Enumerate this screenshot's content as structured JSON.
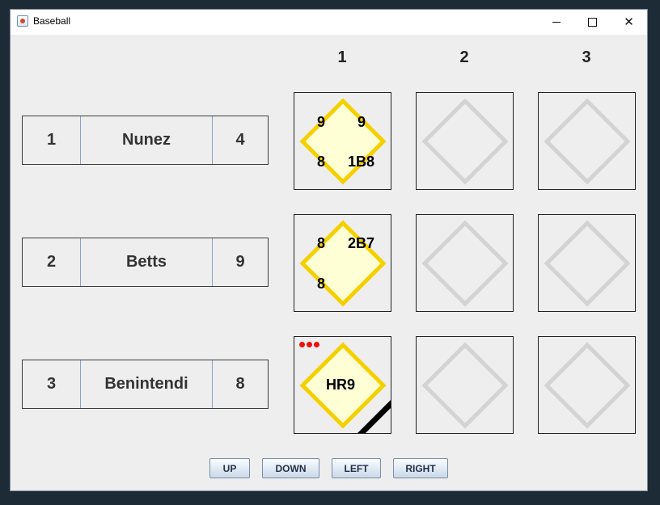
{
  "window": {
    "title": "Baseball"
  },
  "columns": [
    "1",
    "2",
    "3"
  ],
  "rows": [
    {
      "order": "1",
      "name": "Nunez",
      "score": "4"
    },
    {
      "order": "2",
      "name": "Betts",
      "score": "9"
    },
    {
      "order": "3",
      "name": "Benintendi",
      "score": "8"
    }
  ],
  "boxes": {
    "r1c1": {
      "top_left": "9",
      "top_right": "9",
      "bottom_left": "8",
      "bottom_right": "1B8"
    },
    "r2c1": {
      "top_left": "8",
      "top_right": "2B7",
      "bottom_left": "8"
    },
    "r3c1": {
      "center": "HR9",
      "out_dots": 3
    }
  },
  "buttons": {
    "up": "UP",
    "down": "DOWN",
    "left": "LEFT",
    "right": "RIGHT"
  },
  "colors": {
    "active_diamond_stroke": "#f5d000",
    "active_diamond_fill": "#ffffd6",
    "empty_diamond_stroke": "#d3d3d3",
    "out_dot": "#ee1111"
  },
  "icons": {
    "app": "java-cup-icon",
    "minimize": "minimize-icon",
    "maximize": "maximize-icon",
    "close": "close-icon"
  }
}
